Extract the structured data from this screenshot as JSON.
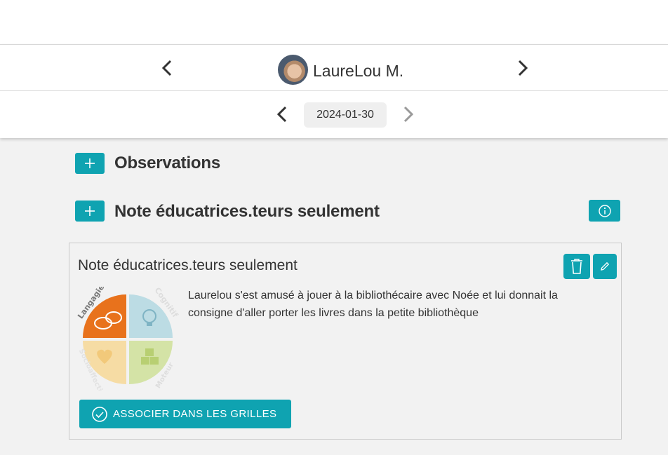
{
  "header": {
    "child_name": "LaureLou M.",
    "date": "2024-01-30"
  },
  "sections": [
    {
      "title": "Observations"
    },
    {
      "title": "Note éducatrices.teurs seulement"
    }
  ],
  "card": {
    "title": "Note éducatrices.teurs seulement",
    "text": "Laurelou s'est amusé à jouer à la bibliothécaire avec Noée et lui donnait la consigne d'aller porter les livres dans la petite bibliothèque",
    "wheel_labels": [
      "Langagier",
      "Cognitif",
      "Socioaffectif",
      "Moteur"
    ],
    "associate_label": "ASSOCIER DANS LES GRILLES"
  },
  "colors": {
    "accent": "#0fa3b1",
    "langagier": "#e8721c",
    "cognitif": "#a9d4df",
    "socioaffectif": "#f6dca4",
    "moteur": "#d4e3a6"
  }
}
